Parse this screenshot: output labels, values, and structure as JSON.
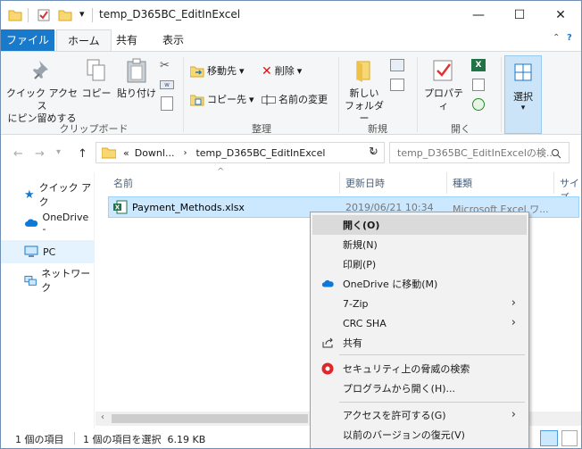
{
  "window": {
    "title": "temp_D365BC_EditInExcel"
  },
  "ribbon_tabs": {
    "file": "ファイル",
    "home": "ホーム",
    "share": "共有",
    "view": "表示"
  },
  "ribbon": {
    "pin": {
      "line1": "クイック アクセス",
      "line2": "にピン留めする"
    },
    "copy": "コピー",
    "paste": "貼り付け",
    "move_to": "移動先",
    "copy_to": "コピー先",
    "delete": "削除",
    "rename": "名前の変更",
    "new_folder": {
      "line1": "新しい",
      "line2": "フォルダー"
    },
    "properties": "プロパティ",
    "select": "選択",
    "groups": {
      "clipboard": "クリップボード",
      "organize": "整理",
      "new": "新規",
      "open": "開く"
    }
  },
  "address": {
    "crumbs": [
      "Downl...",
      "temp_D365BC_EditInExcel"
    ],
    "overflow": "«",
    "search_placeholder": "temp_D365BC_EditInExcelの検..."
  },
  "nav": [
    {
      "label": "クイック アク",
      "icon": "star-icon"
    },
    {
      "label": "OneDrive -",
      "icon": "cloud-icon"
    },
    {
      "label": "PC",
      "icon": "computer-icon"
    },
    {
      "label": "ネットワーク",
      "icon": "network-icon"
    }
  ],
  "columns": {
    "name": "名前",
    "modified": "更新日時",
    "type": "種類",
    "size": "サイズ"
  },
  "files": [
    {
      "name": "Payment_Methods.xlsx",
      "modified": "2019/06/21 10:34",
      "type": "Microsoft Excel ワ..."
    }
  ],
  "status": {
    "count": "1 個の項目",
    "selected": "1 個の項目を選択  6.19 KB"
  },
  "context_menu": [
    {
      "label": "開く(O)",
      "highlight": true
    },
    {
      "label": "新規(N)"
    },
    {
      "label": "印刷(P)"
    },
    {
      "label": "OneDrive に移動(M)",
      "icon": "onedrive-icon"
    },
    {
      "label": "7-Zip",
      "submenu": true
    },
    {
      "label": "CRC SHA",
      "submenu": true
    },
    {
      "label": "共有",
      "icon": "share-icon"
    },
    {
      "label": "セキュリティ上の脅威の検索",
      "icon": "security-scan-icon"
    },
    {
      "label": "プログラムから開く(H)..."
    },
    {
      "label": "アクセスを許可する(G)",
      "submenu": true
    },
    {
      "label": "以前のバージョンの復元(V)"
    }
  ],
  "colors": {
    "accent": "#1979ca",
    "selection": "#cce8ff",
    "excel": "#217346"
  }
}
